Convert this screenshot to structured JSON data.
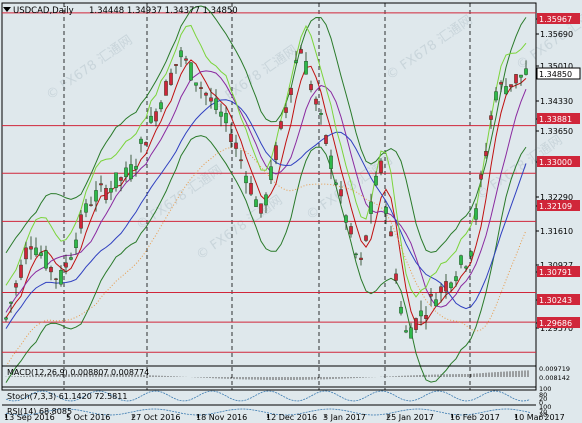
{
  "header": {
    "symbol": "USDCAD,Daily",
    "ohlc": "1.34448 1.34937 1.34377 1.34850"
  },
  "price_axis": {
    "labels": [
      "1.35967",
      "1.35690",
      "1.35010",
      "1.34850",
      "1.34330",
      "1.33881",
      "1.33650",
      "1.33000",
      "1.32290",
      "1.32109",
      "1.31610",
      "1.30927",
      "1.30791",
      "1.30243",
      "1.29570",
      "1.29686"
    ],
    "highlighted": [
      {
        "label": "1.35967",
        "color": "#d0263a"
      },
      {
        "label": "1.34850",
        "color": "#000000"
      },
      {
        "label": "1.33881",
        "color": "#d0263a"
      },
      {
        "label": "1.33000",
        "color": "#d0263a"
      },
      {
        "label": "1.32109",
        "color": "#d0263a"
      },
      {
        "label": "1.30791",
        "color": "#d0263a"
      },
      {
        "label": "1.30243",
        "color": "#d0263a"
      },
      {
        "label": "1.29686",
        "color": "#d0263a"
      }
    ]
  },
  "panels": {
    "macd": {
      "label": "MACD(12,26,9) 0.008807 0.008774",
      "axis": [
        "0.009719",
        "0.008142"
      ]
    },
    "stoch": {
      "label": "Stoch(7,3,3) 61.1420 72.5811",
      "axis": [
        "100",
        "80",
        "20",
        "0"
      ]
    },
    "rsi": {
      "label": "RSI(14) 68.8085",
      "axis": [
        "100",
        "70",
        "30",
        "0"
      ]
    }
  },
  "date_axis": [
    "13 Sep 2016",
    "5 Oct 2016",
    "27 Oct 2016",
    "18 Nov 2016",
    "12 Dec 2016",
    "3 Jan 2017",
    "25 Jan 2017",
    "16 Feb 2017",
    "10 Mar 2017"
  ],
  "watermark": "FX678 汇通网",
  "colors": {
    "background": "#dfe8ec",
    "level_line": "#d0263a",
    "bull": "#2fb84a",
    "bear": "#d0263a",
    "grid_dash": "#000000"
  }
}
